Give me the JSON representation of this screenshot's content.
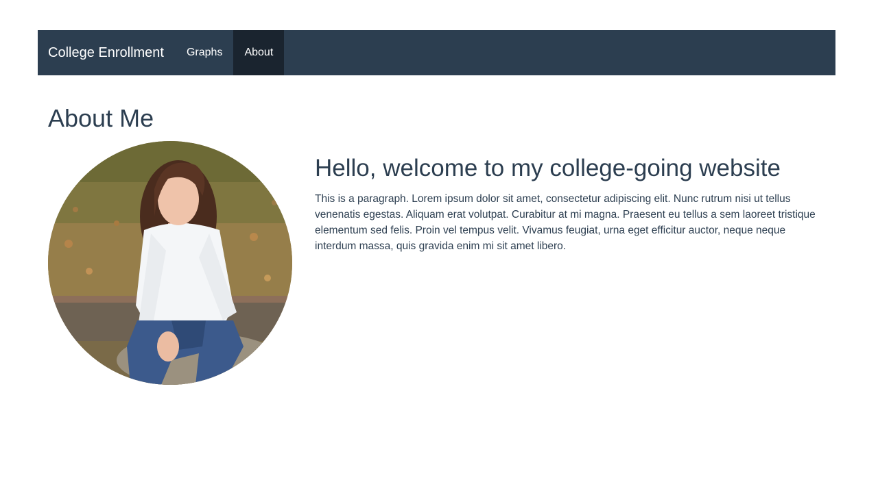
{
  "navbar": {
    "brand": "College Enrollment",
    "links": [
      {
        "label": "Graphs",
        "active": false
      },
      {
        "label": "About",
        "active": true
      }
    ]
  },
  "main": {
    "title": "About Me",
    "heading": "Hello, welcome to my college-going website",
    "paragraph": "This is a paragraph. Lorem ipsum dolor sit amet, consectetur adipiscing elit. Nunc rutrum nisi ut tellus venenatis egestas. Aliquam erat volutpat. Curabitur at mi magna. Praesent eu tellus a sem laoreet tristique elementum sed felis. Proin vel tempus velit. Vivamus feugiat, urna eget efficitur auctor, neque neque interdum massa, quis gravida enim mi sit amet libero."
  },
  "colors": {
    "navbar_bg": "#2c3e50",
    "nav_active_bg": "#1a242f",
    "text": "#2c3e50"
  }
}
